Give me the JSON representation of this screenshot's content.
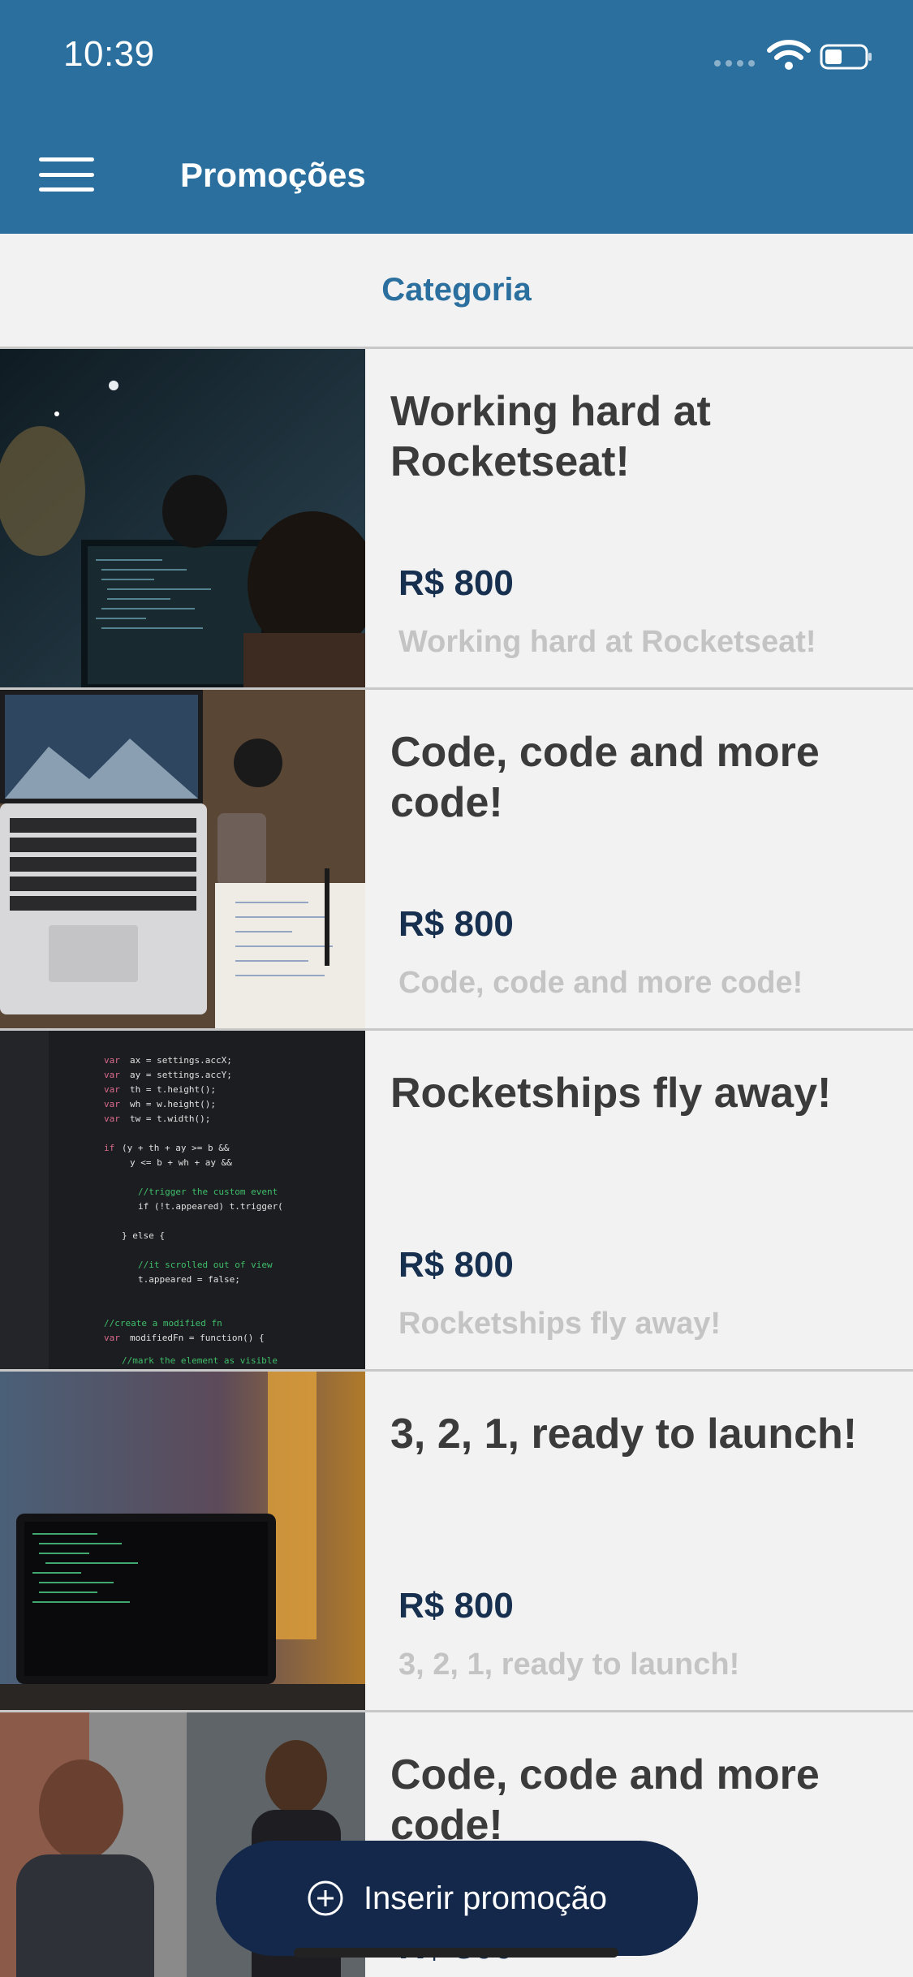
{
  "status_bar": {
    "time": "10:39"
  },
  "header": {
    "title": "Promoções"
  },
  "category": {
    "label": "Categoria"
  },
  "items": [
    {
      "title": "Working hard at Rocketseat!",
      "price": "R$ 800",
      "description": "Working hard at Rocketseat!"
    },
    {
      "title": "Code, code and more code!",
      "price": "R$ 800",
      "description": "Code, code and more code!"
    },
    {
      "title": "Rocketships fly away!",
      "price": "R$ 800",
      "description": "Rocketships fly away!"
    },
    {
      "title": "3, 2, 1, ready to launch!",
      "price": "R$ 800",
      "description": "3, 2, 1, ready to launch!"
    },
    {
      "title": "Code, code and more code!",
      "price": "R$ 800",
      "description": ""
    }
  ],
  "fab": {
    "label": "Inserir promoção",
    "icon": "plus-circle-icon"
  },
  "colors": {
    "header": "#2a6f9e",
    "accent": "#2a6f9e",
    "price": "#17304f",
    "fab": "#13284a"
  }
}
